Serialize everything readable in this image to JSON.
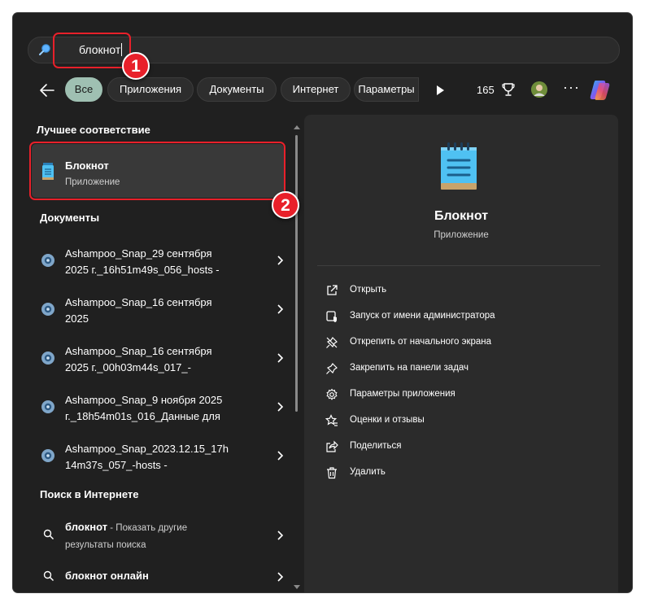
{
  "search": {
    "query": "блокнот"
  },
  "filters": {
    "chips": [
      "Все",
      "Приложения",
      "Документы",
      "Интернет",
      "Параметры"
    ],
    "count": "165"
  },
  "annotations": {
    "step1": "1",
    "step2": "2"
  },
  "best_match": {
    "heading": "Лучшее соответствие",
    "name": "Блокнот",
    "type": "Приложение"
  },
  "documents": {
    "heading": "Документы",
    "items": [
      {
        "line1": "Ashampoo_Snap_29 сентября",
        "line2": "2025 г._16h51m49s_056_hosts -"
      },
      {
        "line1": "Ashampoo_Snap_16 сентября",
        "line2": "2025"
      },
      {
        "line1": "Ashampoo_Snap_16 сентября",
        "line2": "2025 г._00h03m44s_017_-"
      },
      {
        "line1": "Ashampoo_Snap_9 ноября 2025",
        "line2": "г._18h54m01s_016_Данные для"
      },
      {
        "line1": "Ashampoo_Snap_2023.12.15_17h",
        "line2": "14m37s_057_-hosts -"
      }
    ]
  },
  "web": {
    "heading": "Поиск в Интернете",
    "item1": {
      "term": "блокнот",
      "desc": " - Показать другие",
      "desc2": "результаты поиска"
    },
    "item2": {
      "term": "блокнот",
      "bold": " онлайн"
    }
  },
  "details": {
    "title": "Блокнот",
    "subtitle": "Приложение",
    "actions": [
      {
        "icon": "open-icon",
        "label": "Открыть"
      },
      {
        "icon": "admin-shield-icon",
        "label": "Запуск от имени администратора"
      },
      {
        "icon": "unpin-icon",
        "label": "Открепить от начального экрана"
      },
      {
        "icon": "pin-icon",
        "label": "Закрепить на панели задач"
      },
      {
        "icon": "gear-icon",
        "label": "Параметры приложения"
      },
      {
        "icon": "star-review-icon",
        "label": "Оценки и отзывы"
      },
      {
        "icon": "share-icon",
        "label": "Поделиться"
      },
      {
        "icon": "trash-icon",
        "label": "Удалить"
      }
    ]
  },
  "colors": {
    "panel": "#202020",
    "accent_chip": "#9fc0b2",
    "highlight": "#e8202a"
  }
}
